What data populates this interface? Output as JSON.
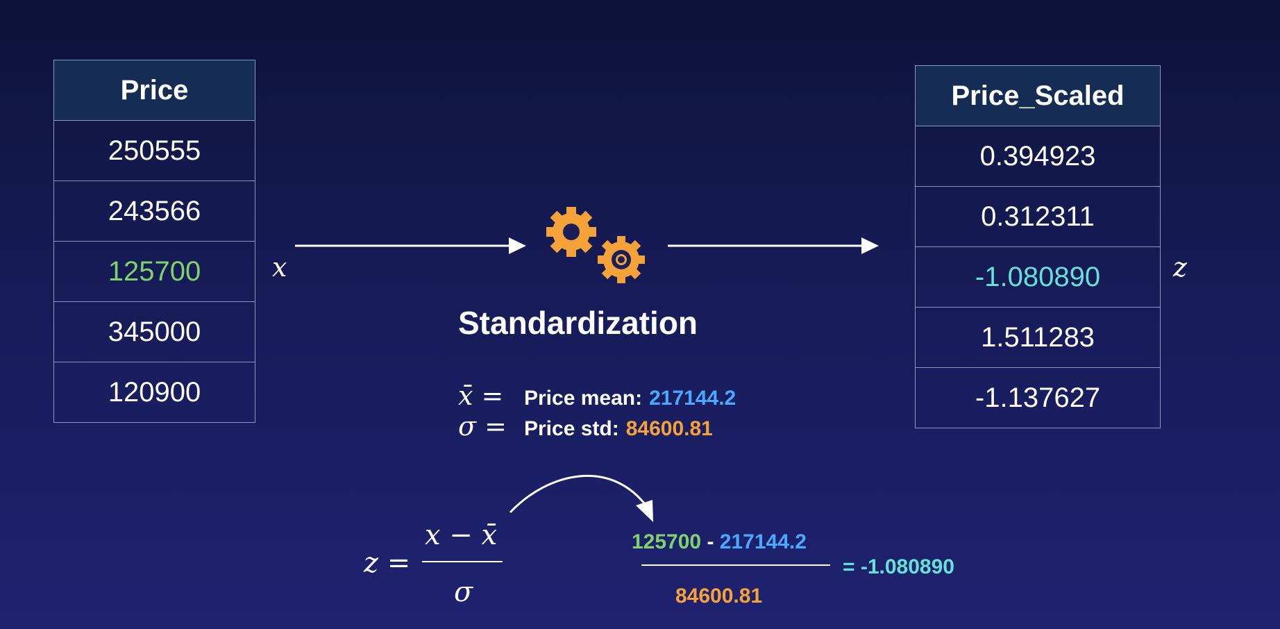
{
  "colors": {
    "background_top": "#0d1238",
    "background_bottom": "#1f2270",
    "table_header": "#152c55",
    "table_border": "#8d97c3",
    "green": "#7fd36a",
    "blue": "#4aa8ff",
    "orange": "#f5a23a",
    "teal": "#65e1d8"
  },
  "left_table": {
    "header": "Price",
    "rows": [
      "250555",
      "243566",
      "125700",
      "345000",
      "120900"
    ],
    "highlight_index": 2
  },
  "right_table": {
    "header": "Price_Scaled",
    "rows": [
      "0.394923",
      "0.312311",
      "-1.080890",
      "1.511283",
      "-1.137627"
    ],
    "highlight_index": 2
  },
  "labels": {
    "x": "x",
    "z": "z",
    "process": "Standardization"
  },
  "stats": {
    "mean_symbol": "x̄ =",
    "mean_label": "Price mean:",
    "mean_value": "217144.2",
    "std_symbol": "σ =",
    "std_label": "Price std:",
    "std_value": "84600.81"
  },
  "formula": {
    "lhs": "z =",
    "numerator": "x − x̄",
    "denominator": "σ"
  },
  "worked": {
    "numerator_left": "125700",
    "numerator_op": " - ",
    "numerator_right": "217144.2",
    "denominator": "84600.81",
    "result": "= -1.080890"
  },
  "icons": {
    "arrow_left": "right-arrow-icon",
    "arrow_right": "right-arrow-icon",
    "gears": "gears-icon",
    "curve_arrow": "curved-arrow-icon"
  }
}
